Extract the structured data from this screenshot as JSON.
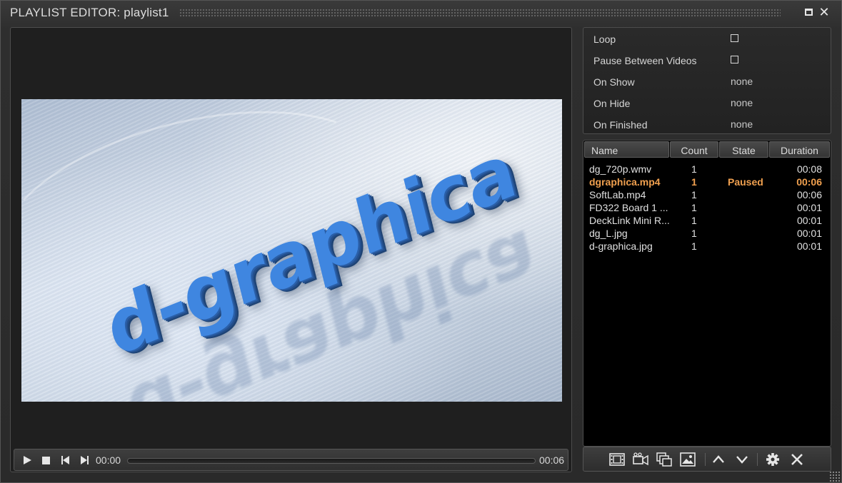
{
  "window": {
    "title": "PLAYLIST EDITOR: playlist1"
  },
  "preview": {
    "logo_text": "d-graphica"
  },
  "transport": {
    "current_time": "00:00",
    "total_time": "00:06",
    "progress": 0.0
  },
  "properties": {
    "loop_label": "Loop",
    "loop_checked": false,
    "pause_between_label": "Pause Between Videos",
    "pause_between_checked": false,
    "on_show_label": "On Show",
    "on_show_value": "none",
    "on_hide_label": "On Hide",
    "on_hide_value": "none",
    "on_finished_label": "On Finished",
    "on_finished_value": "none"
  },
  "playlist": {
    "columns": {
      "name": "Name",
      "count": "Count",
      "state": "State",
      "duration": "Duration"
    },
    "rows": [
      {
        "name": "dg_720p.wmv",
        "count": "1",
        "state": "",
        "duration": "00:08",
        "active": false
      },
      {
        "name": "dgraphica.mp4",
        "count": "1",
        "state": "Paused",
        "duration": "00:06",
        "active": true
      },
      {
        "name": "SoftLab.mp4",
        "count": "1",
        "state": "",
        "duration": "00:06",
        "active": false
      },
      {
        "name": "FD322 Board 1 ...",
        "count": "1",
        "state": "",
        "duration": "00:01",
        "active": false
      },
      {
        "name": "DeckLink Mini R...",
        "count": "1",
        "state": "",
        "duration": "00:01",
        "active": false
      },
      {
        "name": "dg_L.jpg",
        "count": "1",
        "state": "",
        "duration": "00:01",
        "active": false
      },
      {
        "name": "d-graphica.jpg",
        "count": "1",
        "state": "",
        "duration": "00:01",
        "active": false
      }
    ]
  },
  "toolbar": {
    "icons": [
      "add-video-icon",
      "add-camera-icon",
      "add-clone-icon",
      "add-image-icon",
      "move-up-icon",
      "move-down-icon",
      "settings-icon",
      "remove-icon"
    ]
  },
  "colors": {
    "active_row": "#f0a04f",
    "background": "#2b2b2b",
    "list_background": "#000000"
  }
}
